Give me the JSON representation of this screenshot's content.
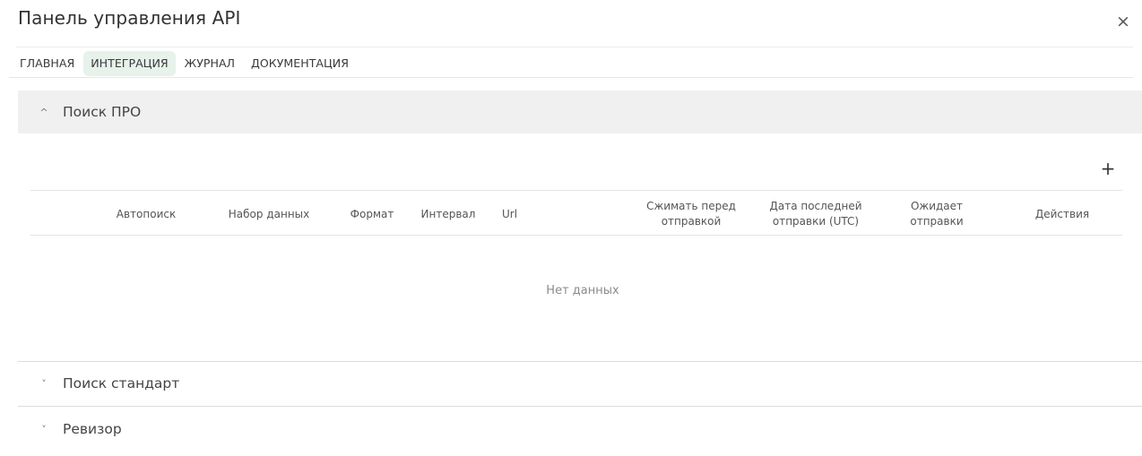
{
  "dialog": {
    "title": "Панель управления API",
    "close_label": "×"
  },
  "tabs": [
    {
      "label": "ГЛАВНАЯ",
      "active": false
    },
    {
      "label": "ИНТЕГРАЦИЯ",
      "active": true
    },
    {
      "label": "ЖУРНАЛ",
      "active": false
    },
    {
      "label": "ДОКУМЕНТАЦИЯ",
      "active": false
    }
  ],
  "sections": [
    {
      "label": "Поиск ПРО",
      "expanded": true,
      "chevron": "^",
      "icon": "chevron-up-icon"
    },
    {
      "label": "Поиск стандарт",
      "expanded": false,
      "chevron": "˅",
      "icon": "chevron-down-icon"
    },
    {
      "label": "Ревизор",
      "expanded": false,
      "chevron": "˅",
      "icon": "chevron-down-icon"
    }
  ],
  "table": {
    "add_label": "+",
    "columns": [
      {
        "line1": "Автопоиск",
        "line2": ""
      },
      {
        "line1": "Набор данных",
        "line2": ""
      },
      {
        "line1": "Формат",
        "line2": ""
      },
      {
        "line1": "Интервал",
        "line2": ""
      },
      {
        "line1": "Url",
        "line2": ""
      },
      {
        "line1": "Сжимать перед",
        "line2": "отправкой"
      },
      {
        "line1": "Дата последней",
        "line2": "отправки (UTC)"
      },
      {
        "line1": "Ожидает",
        "line2": "отправки"
      },
      {
        "line1": "Действия",
        "line2": ""
      }
    ],
    "empty_text": "Нет данных"
  },
  "colors": {
    "active_tab_bg": "#e6f2ea",
    "section_header_bg": "#f0f0f0"
  }
}
